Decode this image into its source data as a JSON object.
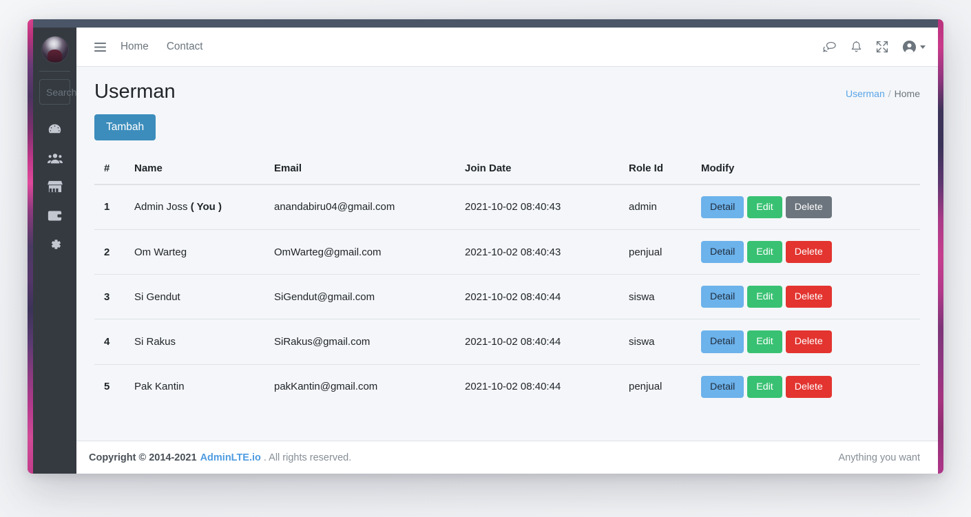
{
  "window": {
    "titlebar_color": "#4b5568",
    "wallpaper_accent": "#c3388a"
  },
  "sidebar": {
    "avatar_name": "user-avatar",
    "search": {
      "value": "",
      "placeholder": "Search"
    },
    "items": [
      {
        "name": "dashboard",
        "icon": "tachometer-icon"
      },
      {
        "name": "users",
        "icon": "users-icon"
      },
      {
        "name": "store",
        "icon": "store-icon"
      },
      {
        "name": "wallet",
        "icon": "wallet-icon"
      },
      {
        "name": "settings",
        "icon": "gear-icon"
      }
    ]
  },
  "navbar": {
    "menu_icon": "hamburger-icon",
    "links": [
      {
        "label": "Home"
      },
      {
        "label": "Contact"
      }
    ],
    "icons": [
      {
        "name": "comments-icon"
      },
      {
        "name": "bell-icon"
      },
      {
        "name": "expand-icon"
      },
      {
        "name": "user-circle-icon"
      }
    ]
  },
  "page": {
    "title": "Userman",
    "breadcrumb": {
      "link": "Userman",
      "separator": "/",
      "current": "Home"
    },
    "add_button": "Tambah"
  },
  "table": {
    "columns": [
      "#",
      "Name",
      "Email",
      "Join Date",
      "Role Id",
      "Modify"
    ],
    "rows": [
      {
        "num": "1",
        "name": "Admin Joss",
        "you": "( You )",
        "email": "anandabiru04@gmail.com",
        "join_date": "2021-10-02 08:40:43",
        "role": "admin",
        "actions": {
          "detail": "Detail",
          "edit": "Edit",
          "delete": "Delete"
        },
        "delete_disabled": true
      },
      {
        "num": "2",
        "name": "Om Warteg",
        "you": "",
        "email": "OmWarteg@gmail.com",
        "join_date": "2021-10-02 08:40:43",
        "role": "penjual",
        "actions": {
          "detail": "Detail",
          "edit": "Edit",
          "delete": "Delete"
        },
        "delete_disabled": false
      },
      {
        "num": "3",
        "name": "Si Gendut",
        "you": "",
        "email": "SiGendut@gmail.com",
        "join_date": "2021-10-02 08:40:44",
        "role": "siswa",
        "actions": {
          "detail": "Detail",
          "edit": "Edit",
          "delete": "Delete"
        },
        "delete_disabled": false
      },
      {
        "num": "4",
        "name": "Si Rakus",
        "you": "",
        "email": "SiRakus@gmail.com",
        "join_date": "2021-10-02 08:40:44",
        "role": "siswa",
        "actions": {
          "detail": "Detail",
          "edit": "Edit",
          "delete": "Delete"
        },
        "delete_disabled": false
      },
      {
        "num": "5",
        "name": "Pak Kantin",
        "you": "",
        "email": "pakKantin@gmail.com",
        "join_date": "2021-10-02 08:40:44",
        "role": "penjual",
        "actions": {
          "detail": "Detail",
          "edit": "Edit",
          "delete": "Delete"
        },
        "delete_disabled": false
      }
    ]
  },
  "footer": {
    "copyright": "Copyright © 2014-2021",
    "brand": "AdminLTE.io",
    "rights": ". All rights reserved.",
    "right_text": "Anything you want"
  },
  "colors": {
    "primary": "#3c8dbc",
    "detail": "#6cb2eb",
    "edit": "#38c172",
    "delete": "#e3342f",
    "disabled": "#6c757d",
    "sidebar_bg": "#343a40",
    "content_bg": "#f4f6f9",
    "link": "#5aa5e8"
  }
}
